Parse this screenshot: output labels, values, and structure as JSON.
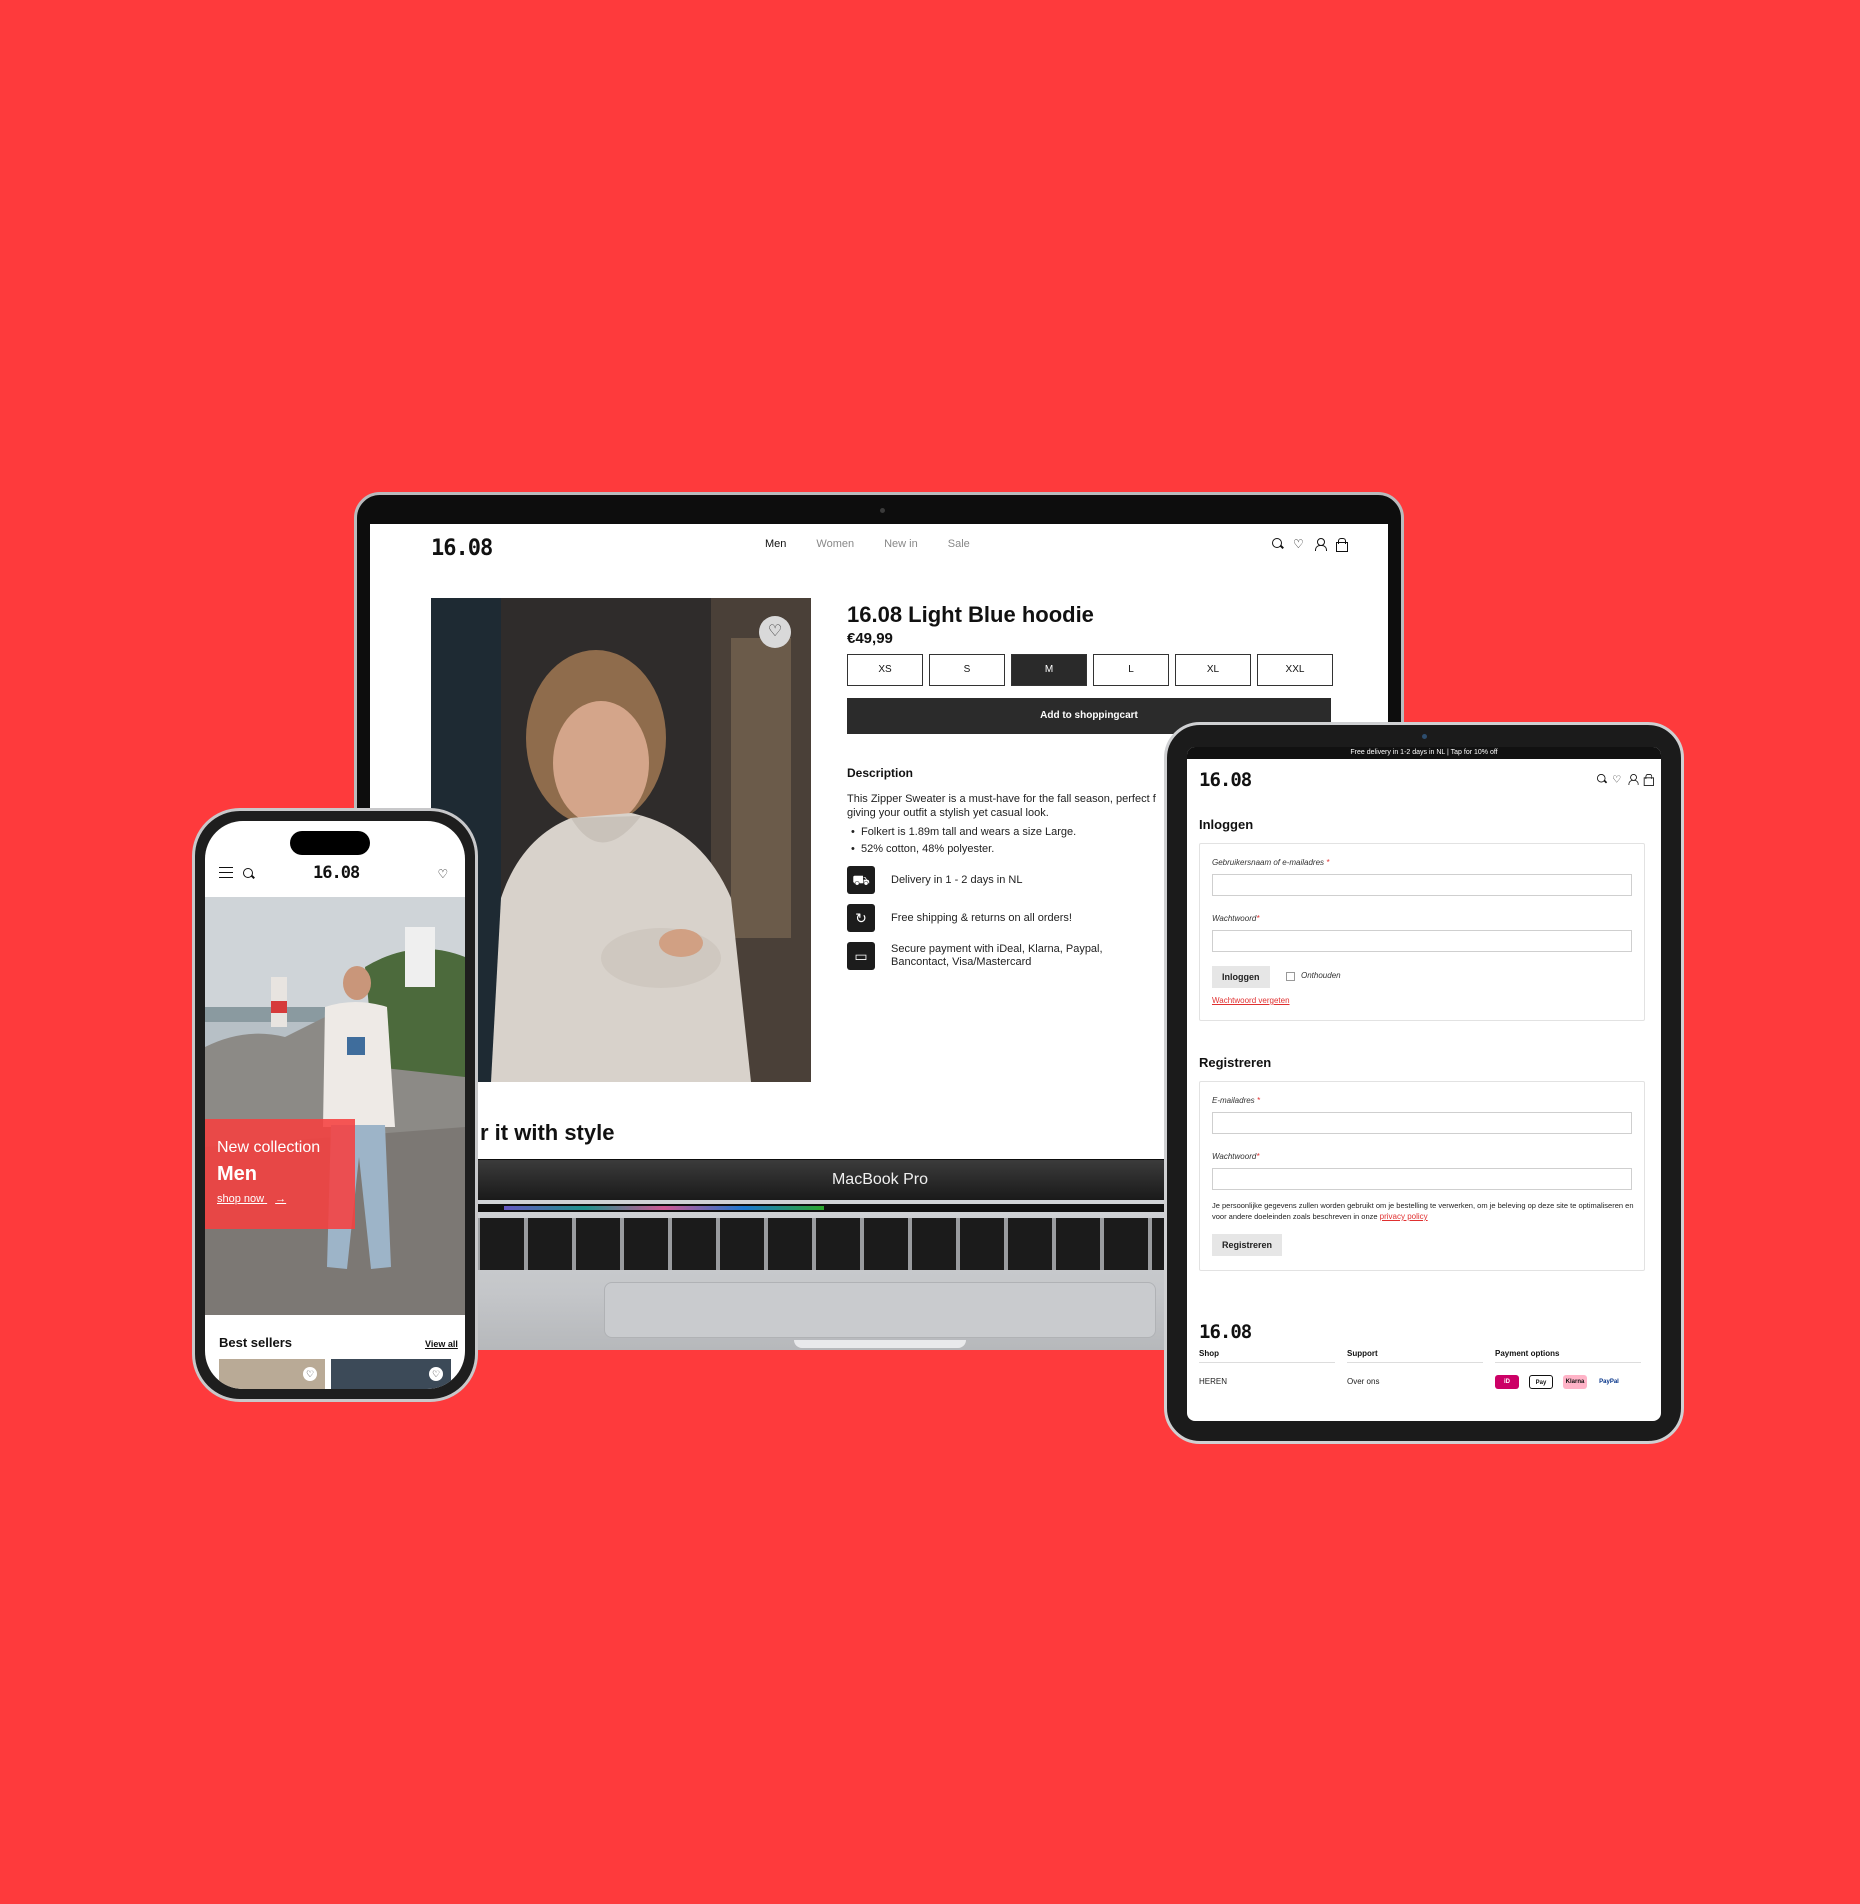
{
  "laptop": {
    "brand_label": "MacBook Pro",
    "logo": "16.08",
    "nav": [
      "Men",
      "Women",
      "New in",
      "Sale"
    ],
    "icons": [
      "search-icon",
      "heart-icon",
      "user-icon",
      "bag-icon"
    ],
    "product": {
      "title": "16.08 Light Blue hoodie",
      "price": "€49,99",
      "sizes": [
        "XS",
        "S",
        "M",
        "L",
        "XL",
        "XXL"
      ],
      "selected_size": "M",
      "add_to_cart": "Add to shoppingcart",
      "description_heading": "Description",
      "description_text": "This Zipper Sweater is a must-have for the fall season, perfect f giving your outfit a stylish yet casual look.",
      "bullets": [
        "Folkert is 1.89m tall and wears a size Large.",
        "52% cotton, 48% polyester."
      ],
      "features": [
        {
          "icon": "truck-icon",
          "text": "Delivery in 1 - 2 days in NL"
        },
        {
          "icon": "return-icon",
          "text": "Free shipping & returns on all orders!"
        },
        {
          "icon": "card-icon",
          "text": "Secure payment with iDeal, Klarna, Paypal, Bancontact, Visa/Mastercard"
        }
      ]
    },
    "style_heading": "r it with style"
  },
  "tablet": {
    "banner": "Free delivery in 1-2 days in NL | Tap for 10% off",
    "logo": "16.08",
    "login": {
      "heading": "Inloggen",
      "username_label": "Gebruikersnaam of e-mailadres",
      "password_label": "Wachtwoord",
      "submit": "Inloggen",
      "remember": "Onthouden",
      "forgot": "Wachtwoord vergeten"
    },
    "register": {
      "heading": "Registreren",
      "email_label": "E-mailadres",
      "password_label": "Wachtwoord",
      "privacy_text": "Je persoonlijke gegevens zullen worden gebruikt om je bestelling te verwerken, om je beleving op deze site te optimaliseren en voor andere doeleinden zoals beschreven in onze",
      "privacy_link": "privacy policy",
      "submit": "Registreren"
    },
    "footer": {
      "logo": "16.08",
      "columns": [
        {
          "heading": "Shop",
          "items": [
            "HEREN"
          ]
        },
        {
          "heading": "Support",
          "items": [
            "Over ons"
          ]
        },
        {
          "heading": "Payment options",
          "items": []
        }
      ],
      "payments": [
        "iD",
        "Pay",
        "Klarna",
        "PayPal"
      ]
    }
  },
  "phone": {
    "logo": "16.08",
    "hero": {
      "subtitle": "New collection",
      "title": "Men",
      "link": "shop now"
    },
    "best_sellers": "Best sellers",
    "view_all": "View all"
  },
  "colors": {
    "background": "#fe3a3c",
    "accent": "#e03030",
    "dark": "#2b2b2b"
  }
}
